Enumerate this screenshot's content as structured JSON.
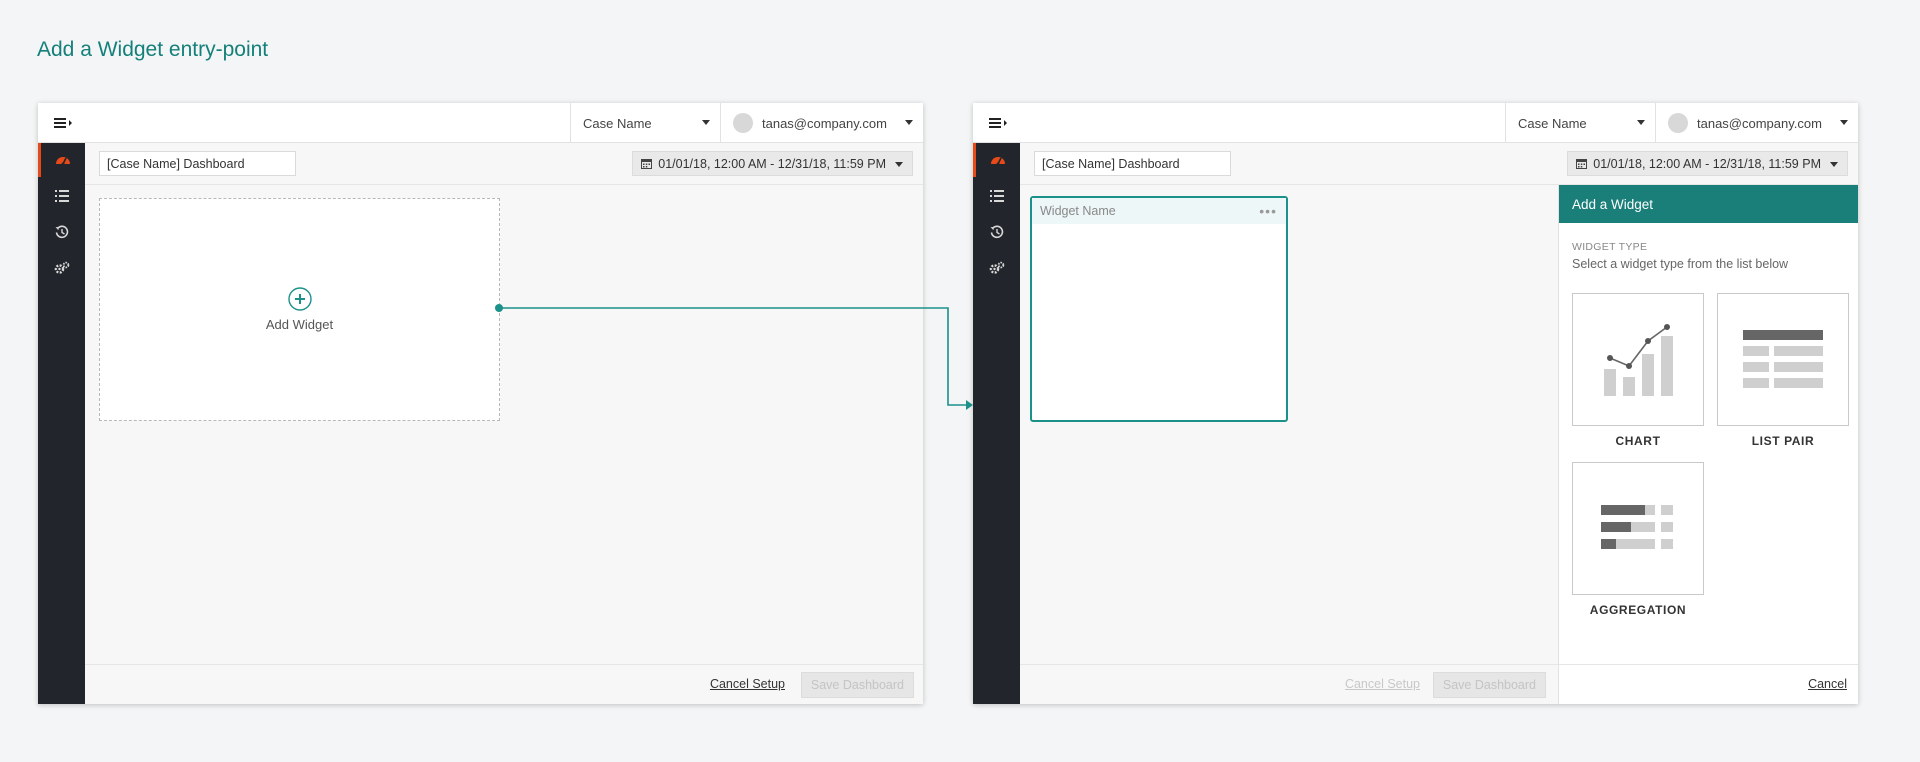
{
  "page_title": "Add a Widget entry-point",
  "screens": {
    "left": {
      "case_name": "Case Name",
      "user_email": "tanas@company.com",
      "dashboard_name": "[Case Name] Dashboard",
      "date_range": "01/01/18, 12:00 AM - 12/31/18, 11:59 PM",
      "add_widget_label": "Add Widget",
      "cancel_setup": "Cancel Setup",
      "save_dashboard": "Save Dashboard"
    },
    "right": {
      "case_name": "Case Name",
      "user_email": "tanas@company.com",
      "dashboard_name": "[Case Name] Dashboard",
      "date_range": "01/01/18, 12:00 AM - 12/31/18, 11:59 PM",
      "widget_name": "Widget Name",
      "cancel_setup": "Cancel Setup",
      "save_dashboard": "Save Dashboard",
      "panel": {
        "title": "Add a Widget",
        "section_label": "WIDGET TYPE",
        "description": "Select a widget type from the list below",
        "types": [
          {
            "label": "CHART",
            "icon": "chart-icon"
          },
          {
            "label": "LIST PAIR",
            "icon": "list-pair-icon"
          },
          {
            "label": "AGGREGATION",
            "icon": "aggregation-icon"
          }
        ],
        "cancel": "Cancel"
      }
    }
  },
  "sidebar_icons": [
    "dashboard-icon",
    "list-icon",
    "history-icon",
    "settings-icon"
  ],
  "colors": {
    "accent": "#1a7e79",
    "title": "#15807a",
    "sidebar": "#22252b",
    "active_indicator": "#e64a19"
  }
}
